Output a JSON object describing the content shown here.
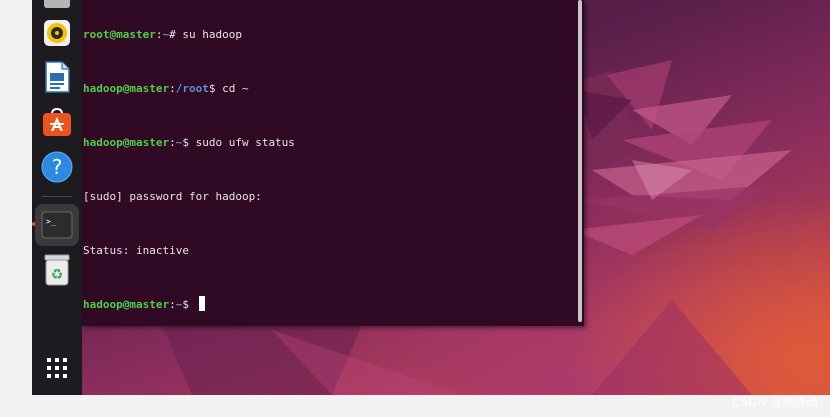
{
  "terminal": {
    "lines": [
      {
        "user": "root@master",
        "path": "~",
        "symbol": "#",
        "cmd": " su hadoop"
      },
      {
        "user": "hadoop@master",
        "path": "/root",
        "symbol": "$",
        "cmd": " cd ~"
      },
      {
        "user": "hadoop@master",
        "path": "~",
        "symbol": "$",
        "cmd": " sudo ufw status"
      },
      {
        "text": "[sudo] password for hadoop:"
      },
      {
        "text": "Status: inactive"
      },
      {
        "user": "hadoop@master",
        "path": "~",
        "symbol": "$",
        "cmd": " "
      }
    ]
  },
  "dock": {
    "items": [
      {
        "name": "files",
        "icon": "files-icon"
      },
      {
        "name": "rhythmbox",
        "icon": "rhythmbox-icon"
      },
      {
        "name": "libreoffice-writer",
        "icon": "writer-icon"
      },
      {
        "name": "ubuntu-software",
        "icon": "software-store-icon"
      },
      {
        "name": "help",
        "icon": "help-icon",
        "glyph": "?"
      },
      {
        "name": "terminal",
        "icon": "terminal-icon",
        "glyph": ">_"
      },
      {
        "name": "trash",
        "icon": "trash-icon",
        "glyph": "♻"
      },
      {
        "name": "show-apps",
        "icon": "apps-grid-icon"
      }
    ]
  },
  "watermark": "CSDN @张謹礦",
  "colors": {
    "terminal_bg": "#300a24",
    "prompt_user": "#4fce4a",
    "prompt_path": "#5a8fd8",
    "dock_bg": "#1e1b20",
    "accent": "#e95420"
  }
}
